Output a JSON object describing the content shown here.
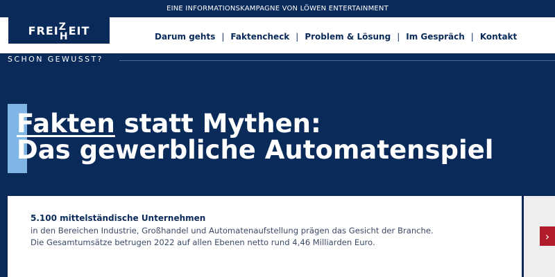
{
  "topbar": {
    "text": "EINE INFORMATIONSKAMPAGNE VON LÖWEN ENTERTAINMENT"
  },
  "logo": {
    "prefix": "FREI",
    "z": "Z",
    "h": "H",
    "suffix": "EIT"
  },
  "nav": {
    "items": [
      {
        "label": "Darum gehts"
      },
      {
        "label": "Faktencheck"
      },
      {
        "label": "Problem & Lösung"
      },
      {
        "label": "Im Gespräch"
      },
      {
        "label": "Kontakt"
      }
    ],
    "separator": "|"
  },
  "kicker": "SCHON GEWUSST?",
  "hero": {
    "highlight": "Fakten",
    "line1_rest": " statt Mythen:",
    "line2": "Das gewerbliche Automatenspiel"
  },
  "card": {
    "title": "5.100 mittelständische Unternehmen",
    "text": "in den Bereichen Industrie, Großhandel und Automatenaufstellung prägen das Gesicht der Branche. Die Gesamtumsätze betrugen 2022 auf allen Ebenen netto rund 4,46 Milliarden Euro."
  },
  "next_button": {
    "glyph": "›"
  },
  "colors": {
    "navy": "#0a2a5a",
    "accent": "#7fb6e6",
    "red": "#b01c2a"
  }
}
